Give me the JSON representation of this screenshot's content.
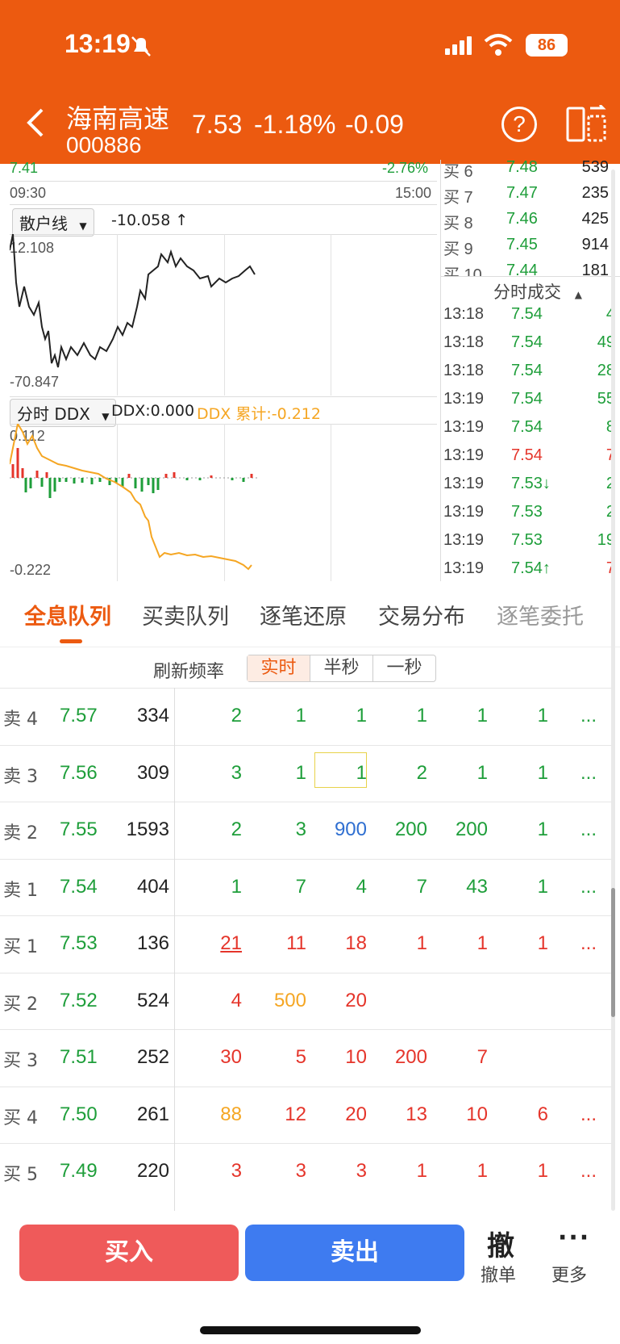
{
  "status_bar": {
    "time": "13:19",
    "battery": "86"
  },
  "header": {
    "name": "海南高速",
    "code": "000886",
    "price": "7.53",
    "pct_change": "-1.18%",
    "change": "-0.09",
    "help": "?"
  },
  "intraday": {
    "top_left_price": "7.41",
    "top_right_pct": "-2.76%",
    "time_start": "09:30",
    "time_end": "15:00"
  },
  "retail_line": {
    "selector": "散户线",
    "value": "-10.058 ↑",
    "max": "12.108",
    "min": "-70.847"
  },
  "ddx": {
    "selector": "分时 DDX",
    "value": "DDX:0.000",
    "cumulative": "DDX 累计:-0.212",
    "max": "0.112",
    "min": "-0.222"
  },
  "order_book": [
    {
      "label": "买 6",
      "price": "7.48",
      "vol": "539"
    },
    {
      "label": "买 7",
      "price": "7.47",
      "vol": "235"
    },
    {
      "label": "买 8",
      "price": "7.46",
      "vol": "425"
    },
    {
      "label": "买 9",
      "price": "7.45",
      "vol": "914"
    },
    {
      "label": "买 10",
      "price": "7.44",
      "vol": "181"
    }
  ],
  "ticks": {
    "title": "分时成交",
    "rows": [
      {
        "time": "13:18",
        "price": "7.54",
        "vol": "4",
        "color": "green"
      },
      {
        "time": "13:18",
        "price": "7.54",
        "vol": "49",
        "color": "green"
      },
      {
        "time": "13:18",
        "price": "7.54",
        "vol": "28",
        "color": "green"
      },
      {
        "time": "13:19",
        "price": "7.54",
        "vol": "55",
        "color": "green"
      },
      {
        "time": "13:19",
        "price": "7.54",
        "vol": "8",
        "color": "green"
      },
      {
        "time": "13:19",
        "price": "7.54",
        "vol": "7",
        "color": "red"
      },
      {
        "time": "13:19",
        "price": "7.53↓",
        "vol": "2",
        "color": "green"
      },
      {
        "time": "13:19",
        "price": "7.53",
        "vol": "2",
        "color": "green"
      },
      {
        "time": "13:19",
        "price": "7.53",
        "vol": "19",
        "color": "green"
      },
      {
        "time": "13:19",
        "price": "7.54↑",
        "vol": "7",
        "color": "red"
      }
    ]
  },
  "tabs": [
    "全息队列",
    "买卖队列",
    "逐笔还原",
    "交易分布",
    "逐笔委托"
  ],
  "refresh": {
    "label": "刷新频率",
    "options": [
      "实时",
      "半秒",
      "一秒"
    ]
  },
  "queue": [
    {
      "label": "卖 4",
      "price": "7.57",
      "vol": "334",
      "cells": [
        [
          "2",
          "green"
        ],
        [
          "1",
          "green"
        ],
        [
          "1",
          "green"
        ],
        [
          "1",
          "green"
        ],
        [
          "1",
          "green"
        ],
        [
          "1",
          "green"
        ]
      ],
      "more": "..."
    },
    {
      "label": "卖 3",
      "price": "7.56",
      "vol": "309",
      "cells": [
        [
          "3",
          "green"
        ],
        [
          "1",
          "green"
        ],
        [
          "1",
          "green"
        ],
        [
          "2",
          "green"
        ],
        [
          "1",
          "green"
        ],
        [
          "1",
          "green"
        ]
      ],
      "more": "..."
    },
    {
      "label": "卖 2",
      "price": "7.55",
      "vol": "1593",
      "cells": [
        [
          "2",
          "green"
        ],
        [
          "3",
          "green"
        ],
        [
          "900",
          "blue"
        ],
        [
          "200",
          "green"
        ],
        [
          "200",
          "green"
        ],
        [
          "1",
          "green"
        ]
      ],
      "more": "..."
    },
    {
      "label": "卖 1",
      "price": "7.54",
      "vol": "404",
      "cells": [
        [
          "1",
          "green"
        ],
        [
          "7",
          "green"
        ],
        [
          "4",
          "green"
        ],
        [
          "7",
          "green"
        ],
        [
          "43",
          "green"
        ],
        [
          "1",
          "green"
        ]
      ],
      "more": "..."
    },
    {
      "label": "买 1",
      "price": "7.53",
      "vol": "136",
      "cells": [
        [
          "21",
          "red"
        ],
        [
          "11",
          "red"
        ],
        [
          "18",
          "red"
        ],
        [
          "1",
          "red"
        ],
        [
          "1",
          "red"
        ],
        [
          "1",
          "red"
        ]
      ],
      "more": "..."
    },
    {
      "label": "买 2",
      "price": "7.52",
      "vol": "524",
      "cells": [
        [
          "4",
          "red"
        ],
        [
          "500",
          "orange"
        ],
        [
          "20",
          "red"
        ]
      ],
      "more": ""
    },
    {
      "label": "买 3",
      "price": "7.51",
      "vol": "252",
      "cells": [
        [
          "30",
          "red"
        ],
        [
          "5",
          "red"
        ],
        [
          "10",
          "red"
        ],
        [
          "200",
          "red"
        ],
        [
          "7",
          "red"
        ]
      ],
      "more": ""
    },
    {
      "label": "买 4",
      "price": "7.50",
      "vol": "261",
      "cells": [
        [
          "88",
          "orange"
        ],
        [
          "12",
          "red"
        ],
        [
          "20",
          "red"
        ],
        [
          "13",
          "red"
        ],
        [
          "10",
          "red"
        ],
        [
          "6",
          "red"
        ]
      ],
      "more": "..."
    },
    {
      "label": "买 5",
      "price": "7.49",
      "vol": "220",
      "cells": [
        [
          "3",
          "red"
        ],
        [
          "3",
          "red"
        ],
        [
          "3",
          "red"
        ],
        [
          "1",
          "red"
        ],
        [
          "1",
          "red"
        ],
        [
          "1",
          "red"
        ]
      ],
      "more": "..."
    }
  ],
  "bottom": {
    "buy": "买入",
    "sell": "卖出",
    "cancel_icon": "撤",
    "cancel": "撤单",
    "more_icon": "···",
    "more": "更多"
  },
  "colors": {
    "header": "#ec5a10",
    "up": "#e5352b",
    "down": "#1e9e3a",
    "big": "#f5a623",
    "huge": "#2f6fd1"
  }
}
